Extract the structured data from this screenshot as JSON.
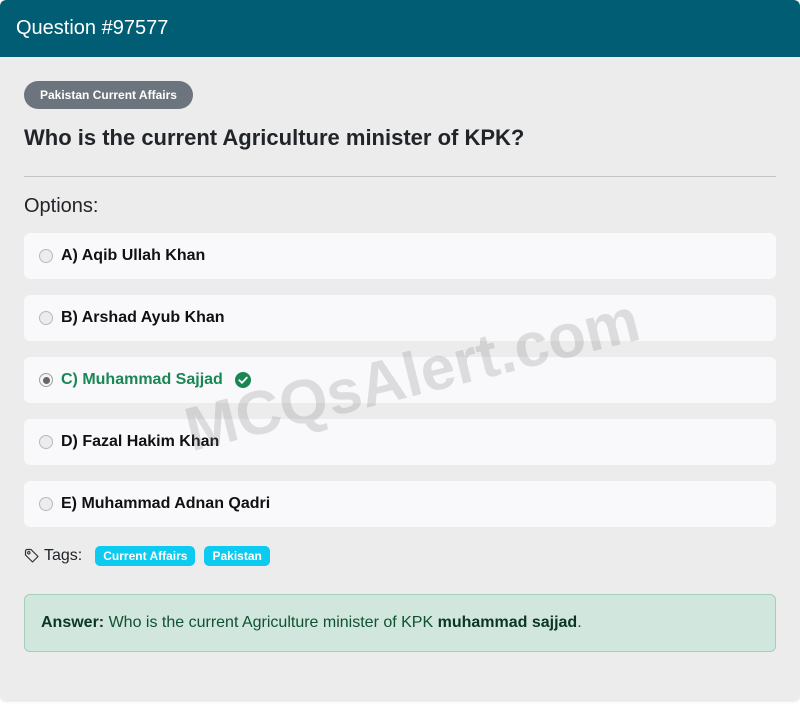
{
  "header": {
    "title": "Question #97577"
  },
  "category": {
    "label": "Pakistan Current Affairs"
  },
  "question": {
    "text": "Who is the current Agriculture minister of KPK?"
  },
  "options_label": "Options:",
  "options": [
    {
      "letter": "A)",
      "label": "A) Aqib Ullah Khan",
      "selected": false,
      "correct": false
    },
    {
      "letter": "B)",
      "label": "B) Arshad Ayub Khan",
      "selected": false,
      "correct": false
    },
    {
      "letter": "C)",
      "label": "C) Muhammad Sajjad",
      "selected": true,
      "correct": true
    },
    {
      "letter": "D)",
      "label": "D) Fazal Hakim Khan",
      "selected": false,
      "correct": false
    },
    {
      "letter": "E)",
      "label": "E) Muhammad Adnan Qadri",
      "selected": false,
      "correct": false
    }
  ],
  "tags": {
    "label": "Tags:",
    "items": [
      "Current Affairs",
      "Pakistan"
    ]
  },
  "answer": {
    "prefix": "Answer:",
    "text": " Who is the current Agriculture minister of KPK ",
    "value": "muhammad sajjad",
    "suffix": "."
  },
  "watermark": "MCQsAlert.com",
  "colors": {
    "header_bg": "#005d73",
    "category_pill": "#6c757d",
    "correct_green": "#198754",
    "tag_badge": "#0dcaf0",
    "answer_bg": "#d1e7dd"
  },
  "icons": {
    "correct": "check-circle-icon",
    "tags": "tag-icon"
  }
}
